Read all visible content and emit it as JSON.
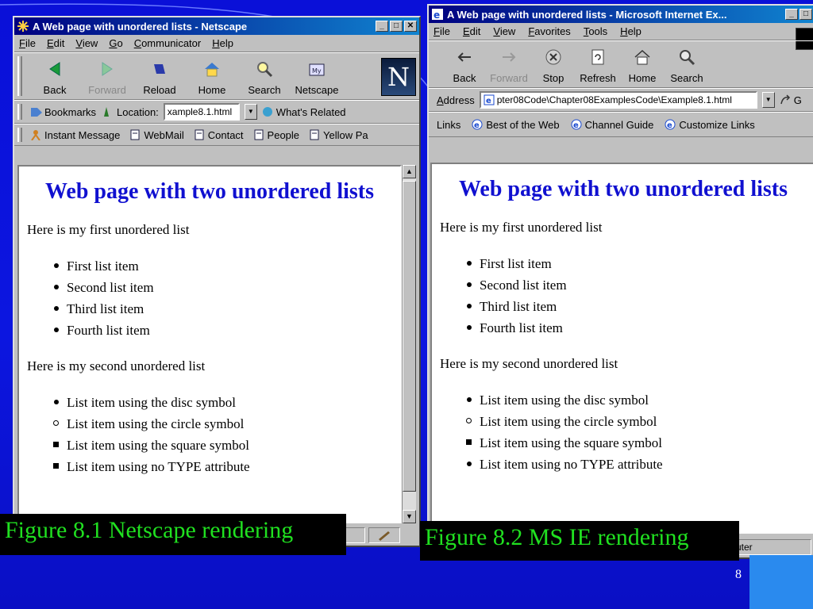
{
  "netscape": {
    "title": "A Web page with unordered lists - Netscape",
    "menu": [
      "File",
      "Edit",
      "View",
      "Go",
      "Communicator",
      "Help"
    ],
    "toolbar": [
      {
        "label": "Back",
        "icon": "back-arrow-icon"
      },
      {
        "label": "Forward",
        "icon": "forward-arrow-icon"
      },
      {
        "label": "Reload",
        "icon": "reload-icon"
      },
      {
        "label": "Home",
        "icon": "home-icon"
      },
      {
        "label": "Search",
        "icon": "search-icon"
      },
      {
        "label": "Netscape",
        "icon": "netscape-icon"
      }
    ],
    "bookmarks_label": "Bookmarks",
    "location_label": "Location:",
    "location_value": "xample8.1.html",
    "whats_related": "What's Related",
    "personal": [
      "Instant Message",
      "WebMail",
      "Contact",
      "People",
      "Yellow Pa"
    ]
  },
  "ie": {
    "title": "A Web page with unordered lists - Microsoft Internet Ex...",
    "menu": [
      "File",
      "Edit",
      "View",
      "Favorites",
      "Tools",
      "Help"
    ],
    "toolbar": [
      {
        "label": "Back",
        "icon": "back-arrow-icon"
      },
      {
        "label": "Forward",
        "icon": "forward-arrow-icon"
      },
      {
        "label": "Stop",
        "icon": "stop-icon"
      },
      {
        "label": "Refresh",
        "icon": "refresh-icon"
      },
      {
        "label": "Home",
        "icon": "home-icon"
      },
      {
        "label": "Search",
        "icon": "search-icon"
      }
    ],
    "address_label": "Address",
    "address_value": "pter08Code\\Chapter08ExamplesCode\\Example8.1.html",
    "go_label": "G",
    "links_label": "Links",
    "links": [
      "Best of the Web",
      "Channel Guide",
      "Customize Links"
    ],
    "status_text": "uter"
  },
  "page": {
    "heading": "Web page with two unordered lists",
    "intro1": "Here is my first unordered list",
    "list1": [
      "First list item",
      "Second list item",
      "Third list item",
      "Fourth list item"
    ],
    "intro2": "Here is my second unordered list",
    "list2": [
      {
        "text": "List item using the disc symbol",
        "type": "disc"
      },
      {
        "text": "List item using the circle symbol",
        "type": "circle"
      },
      {
        "text": "List item using the square symbol",
        "type": "square"
      },
      {
        "text": "List item using no TYPE attribute",
        "type": "square"
      }
    ],
    "list2_ie_types": [
      "disc",
      "circle",
      "square",
      "disc"
    ]
  },
  "captions": {
    "netscape": "Figure 8.1 Netscape rendering",
    "ie": "Figure 8.2 MS IE rendering"
  },
  "slide_number": "8",
  "colors": {
    "background": "#0c16e0",
    "caption_text": "#20e020",
    "heading": "#1010d0",
    "titlebar": "#000080"
  }
}
